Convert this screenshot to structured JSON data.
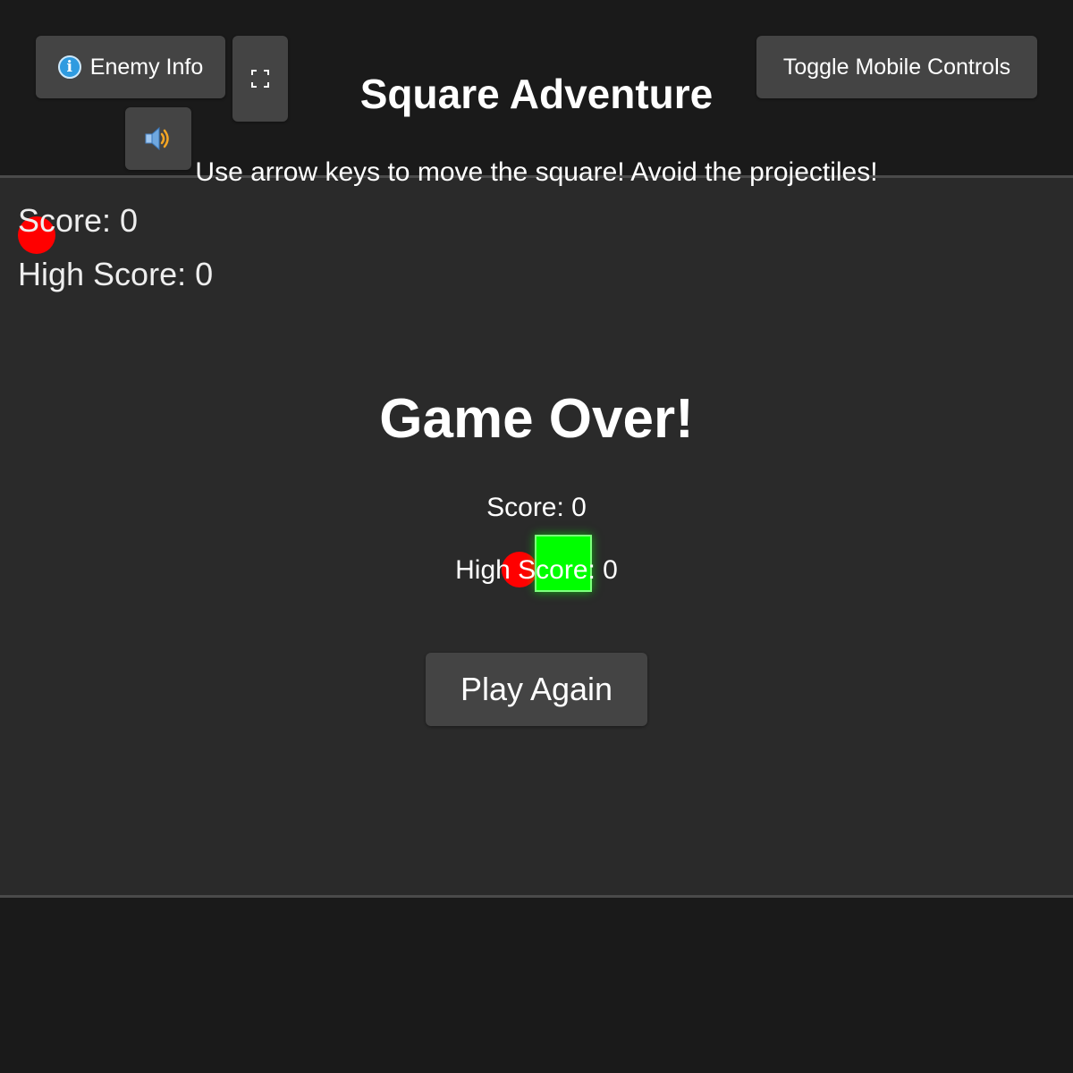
{
  "header": {
    "title": "Square Adventure",
    "instructions": "Use arrow keys to move the square! Avoid the projectiles!",
    "enemy_info_label": "Enemy Info",
    "toggle_mobile_label": "Toggle Mobile Controls",
    "icons": {
      "enemy_info": "info-icon",
      "fullscreen": "fullscreen-icon",
      "sound": "speaker-icon"
    }
  },
  "hud": {
    "score": "Score: 0",
    "high_score": "High Score: 0"
  },
  "game_over": {
    "title": "Game Over!",
    "score": "Score: 0",
    "high_score": "High Score: 0",
    "play_again_label": "Play Again"
  },
  "colors": {
    "page_background": "#1a1a1a",
    "game_background": "#2a2a2a",
    "button": "#444444",
    "player": "#00ff00",
    "projectile": "#ff0000"
  }
}
